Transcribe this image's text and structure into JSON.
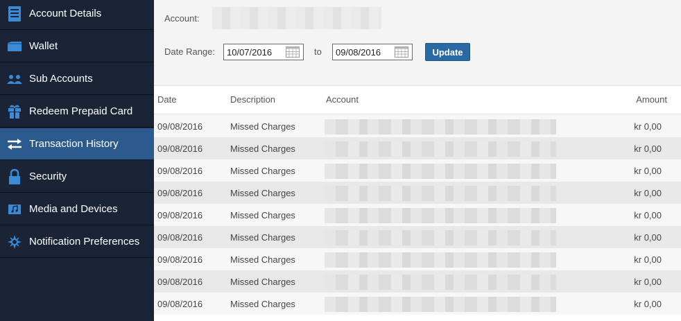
{
  "sidebar": {
    "items": [
      {
        "label": "Account Details",
        "icon": "account-details-icon"
      },
      {
        "label": "Wallet",
        "icon": "wallet-icon"
      },
      {
        "label": "Sub Accounts",
        "icon": "sub-accounts-icon"
      },
      {
        "label": "Redeem Prepaid Card",
        "icon": "gift-icon"
      },
      {
        "label": "Transaction History",
        "icon": "transfer-arrows-icon",
        "active": true
      },
      {
        "label": "Security",
        "icon": "lock-icon"
      },
      {
        "label": "Media and Devices",
        "icon": "media-icon"
      },
      {
        "label": "Notification Preferences",
        "icon": "notification-burst-icon"
      }
    ]
  },
  "filters": {
    "account_label": "Account:",
    "date_range_label": "Date Range:",
    "from_date": "10/07/2016",
    "to_label": "to",
    "to_date": "09/08/2016",
    "update_label": "Update"
  },
  "table": {
    "headers": {
      "date": "Date",
      "description": "Description",
      "account": "Account",
      "amount": "Amount"
    },
    "rows": [
      {
        "date": "09/08/2016",
        "description": "Missed Charges",
        "amount": "kr 0,00"
      },
      {
        "date": "09/08/2016",
        "description": "Missed Charges",
        "amount": "kr 0,00"
      },
      {
        "date": "09/08/2016",
        "description": "Missed Charges",
        "amount": "kr 0,00"
      },
      {
        "date": "09/08/2016",
        "description": "Missed Charges",
        "amount": "kr 0,00"
      },
      {
        "date": "09/08/2016",
        "description": "Missed Charges",
        "amount": "kr 0,00"
      },
      {
        "date": "09/08/2016",
        "description": "Missed Charges",
        "amount": "kr 0,00"
      },
      {
        "date": "09/08/2016",
        "description": "Missed Charges",
        "amount": "kr 0,00"
      },
      {
        "date": "09/08/2016",
        "description": "Missed Charges",
        "amount": "kr 0,00"
      },
      {
        "date": "09/08/2016",
        "description": "Missed Charges",
        "amount": "kr 0,00"
      }
    ]
  },
  "colors": {
    "sidebar_bg": "#1b2336",
    "active_item_bg": "#2b5b8e",
    "icon_blue": "#3a8ad6",
    "update_button": "#2a6aa4"
  }
}
